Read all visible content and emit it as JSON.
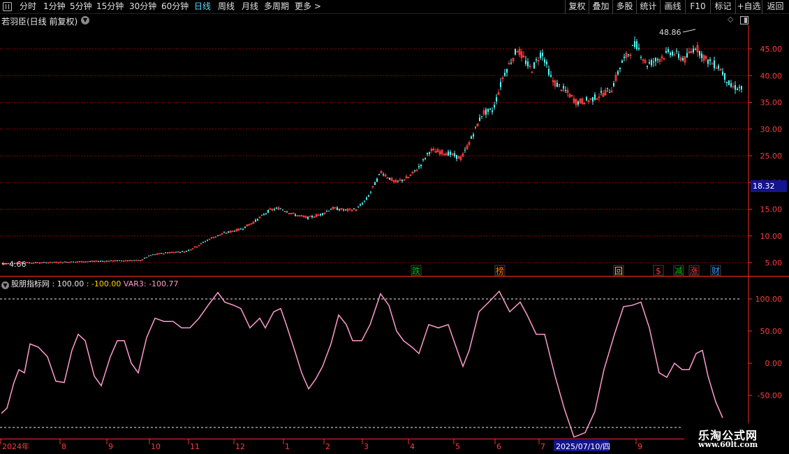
{
  "toolbar": {
    "menu_icon": "menu-icon",
    "periods": [
      {
        "label": "分时"
      },
      {
        "label": "1分钟"
      },
      {
        "label": "5分钟"
      },
      {
        "label": "15分钟"
      },
      {
        "label": "30分钟"
      },
      {
        "label": "60分钟"
      },
      {
        "label": "日线",
        "active": true
      },
      {
        "label": "周线"
      },
      {
        "label": "月线"
      },
      {
        "label": "多周期"
      },
      {
        "label": "更多 >"
      }
    ],
    "right_buttons": [
      "复权",
      "叠加",
      "多股",
      "统计",
      "画线",
      "F10",
      "标记",
      "+自选",
      "返回"
    ]
  },
  "main_chart": {
    "title": "若羽臣(日线 前复权)",
    "high_label": "48.86",
    "low_label": "4.66",
    "current_price": "18.32",
    "y_ticks": [
      "45.00",
      "40.00",
      "35.00",
      "30.00",
      "25.00",
      "20.00",
      "15.00",
      "10.00",
      "5.00"
    ],
    "event_markers": [
      {
        "text": "跌",
        "color": "#00c000"
      },
      {
        "text": "榜",
        "color": "#ff7a00"
      },
      {
        "text": "回",
        "color": "#ffcc33"
      },
      {
        "text": "$",
        "color": "#ff3030"
      },
      {
        "text": "减",
        "color": "#00c000"
      },
      {
        "text": "涨",
        "color": "#ff3030"
      },
      {
        "text": "财",
        "color": "#3399ff"
      }
    ],
    "colors": {
      "up": "#ff3c3c",
      "down": "#54ffff",
      "grid": "#8b0000",
      "axis": "#ff2a2a"
    }
  },
  "indicator": {
    "name": "股朋指标网",
    "v1": ": 100.00",
    "v2": ": -100.00",
    "v3": "VAR3: -100.77",
    "y_ticks": [
      "100.00",
      "50.00",
      "0.00",
      "-50.00"
    ],
    "line_color": "#ff9bd0"
  },
  "date_axis": {
    "labels": [
      "2024年",
      "8",
      "9",
      "10",
      "11",
      "12",
      "1",
      "2",
      "3",
      "4",
      "5",
      "6",
      "7",
      "9"
    ],
    "cursor_date": "2025/07/10/四"
  },
  "watermark": {
    "title": "乐淘公式网",
    "url": "www.60lt.com"
  }
}
